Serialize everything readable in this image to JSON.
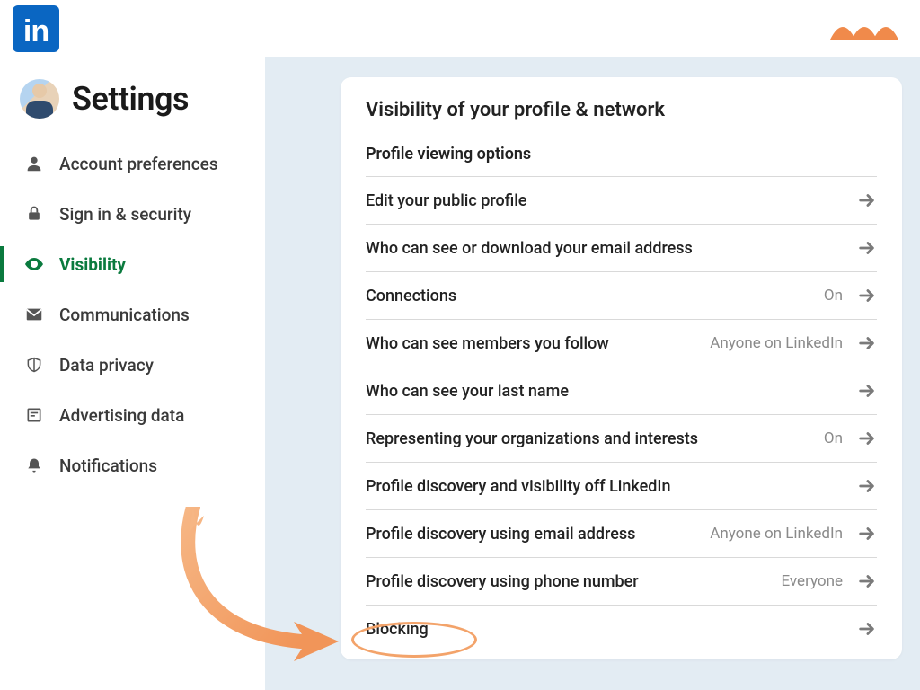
{
  "header": {
    "logo_text": "in"
  },
  "sidebar": {
    "title": "Settings",
    "items": [
      {
        "label": "Account preferences",
        "icon": "person-icon",
        "active": false
      },
      {
        "label": "Sign in & security",
        "icon": "lock-icon",
        "active": false
      },
      {
        "label": "Visibility",
        "icon": "eye-icon",
        "active": true
      },
      {
        "label": "Communications",
        "icon": "mail-icon",
        "active": false
      },
      {
        "label": "Data privacy",
        "icon": "shield-icon",
        "active": false
      },
      {
        "label": "Advertising data",
        "icon": "doc-icon",
        "active": false
      },
      {
        "label": "Notifications",
        "icon": "bell-icon",
        "active": false
      }
    ]
  },
  "panel": {
    "title": "Visibility of your profile & network",
    "section": "Profile viewing options",
    "rows": [
      {
        "label": "Edit your public profile",
        "value": ""
      },
      {
        "label": "Who can see or download your email address",
        "value": ""
      },
      {
        "label": "Connections",
        "value": "On"
      },
      {
        "label": "Who can see members you follow",
        "value": "Anyone on LinkedIn"
      },
      {
        "label": "Who can see your last name",
        "value": ""
      },
      {
        "label": "Representing your organizations and interests",
        "value": "On"
      },
      {
        "label": "Profile discovery and visibility off LinkedIn",
        "value": ""
      },
      {
        "label": "Profile discovery using email address",
        "value": "Anyone on LinkedIn"
      },
      {
        "label": "Profile discovery using phone number",
        "value": "Everyone"
      },
      {
        "label": "Blocking",
        "value": ""
      }
    ]
  },
  "annotation": {
    "highlight_target": "Blocking",
    "accent_color": "#f3a36a"
  }
}
